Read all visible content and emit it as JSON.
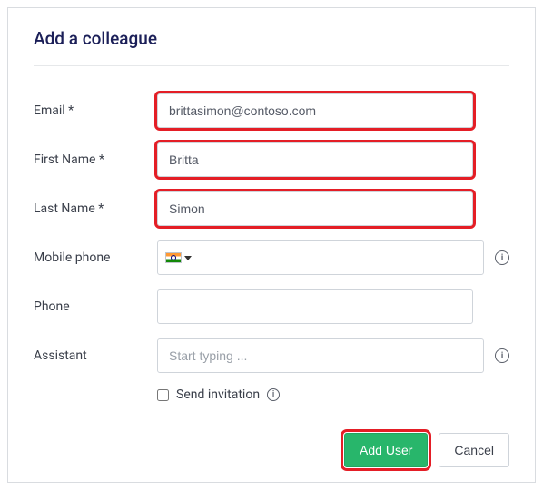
{
  "title": "Add a colleague",
  "fields": {
    "email": {
      "label": "Email *",
      "value": "brittasimon@contoso.com"
    },
    "firstName": {
      "label": "First Name *",
      "value": "Britta"
    },
    "lastName": {
      "label": "Last Name *",
      "value": "Simon"
    },
    "mobile": {
      "label": "Mobile phone",
      "value": ""
    },
    "phone": {
      "label": "Phone",
      "value": ""
    },
    "assistant": {
      "label": "Assistant",
      "placeholder": "Start typing ...",
      "value": ""
    }
  },
  "sendInvitation": {
    "label": "Send invitation",
    "checked": false
  },
  "buttons": {
    "primary": "Add User",
    "secondary": "Cancel"
  }
}
